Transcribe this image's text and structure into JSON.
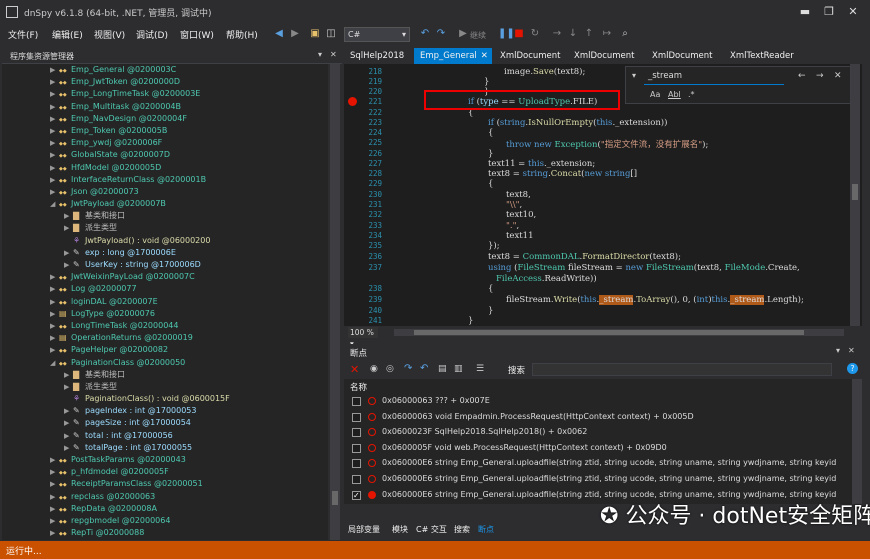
{
  "window": {
    "title": "dnSpy v6.1.8 (64-bit, .NET, 管理员, 调试中)"
  },
  "menu": [
    "文件(F)",
    "编辑(E)",
    "视图(V)",
    "调试(D)",
    "窗口(W)",
    "帮助(H)"
  ],
  "toolbar": {
    "language": "C#",
    "continue_label": "继续"
  },
  "explorer": {
    "title": "程序集资源管理器",
    "items": [
      {
        "icon": "class",
        "indent": 0,
        "exp": "▶",
        "text": "Emp_General @0200003C",
        "k": "t"
      },
      {
        "icon": "class",
        "indent": 0,
        "exp": "▶",
        "text": "Emp_JwtToken @0200000D",
        "k": "t"
      },
      {
        "icon": "class",
        "indent": 0,
        "exp": "▶",
        "text": "Emp_LongTimeTask @0200003E",
        "k": "t"
      },
      {
        "icon": "class",
        "indent": 0,
        "exp": "▶",
        "text": "Emp_Multitask @0200004B",
        "k": "t"
      },
      {
        "icon": "class",
        "indent": 0,
        "exp": "▶",
        "text": "Emp_NavDesign @0200004F",
        "k": "t"
      },
      {
        "icon": "class",
        "indent": 0,
        "exp": "▶",
        "text": "Emp_Token @0200005B",
        "k": "t"
      },
      {
        "icon": "class",
        "indent": 0,
        "exp": "▶",
        "text": "Emp_ywdj @0200006F",
        "k": "t"
      },
      {
        "icon": "class",
        "indent": 0,
        "exp": "▶",
        "text": "GlobalState @0200007D",
        "k": "t"
      },
      {
        "icon": "class",
        "indent": 0,
        "exp": "▶",
        "text": "HfdModel @0200005D",
        "k": "t"
      },
      {
        "icon": "class",
        "indent": 0,
        "exp": "▶",
        "text": "InterfaceReturnClass @0200001B",
        "k": "t"
      },
      {
        "icon": "class",
        "indent": 0,
        "exp": "▶",
        "text": "Json @02000073",
        "k": "t"
      },
      {
        "icon": "class",
        "indent": 0,
        "exp": "◢",
        "text": "JwtPayload @0200007B",
        "k": "t"
      },
      {
        "icon": "folder",
        "indent": 1,
        "exp": "▶",
        "text": "基类和接口",
        "k": "g"
      },
      {
        "icon": "folder",
        "indent": 1,
        "exp": "▶",
        "text": "派生类型",
        "k": "g"
      },
      {
        "icon": "method",
        "indent": 1,
        "exp": "",
        "text": "JwtPayload() : void @06000200",
        "k": "m"
      },
      {
        "icon": "prop",
        "indent": 1,
        "exp": "▶",
        "text": "exp : long @1700006E",
        "k": "f"
      },
      {
        "icon": "prop",
        "indent": 1,
        "exp": "▶",
        "text": "UserKey : string @1700006D",
        "k": "f"
      },
      {
        "icon": "class",
        "indent": 0,
        "exp": "▶",
        "text": "JwtWeixinPayLoad @0200007C",
        "k": "t"
      },
      {
        "icon": "class",
        "indent": 0,
        "exp": "▶",
        "text": "Log @02000077",
        "k": "t"
      },
      {
        "icon": "class",
        "indent": 0,
        "exp": "▶",
        "text": "loginDAL @0200007E",
        "k": "t"
      },
      {
        "icon": "enum",
        "indent": 0,
        "exp": "▶",
        "text": "LogType @02000076",
        "k": "t"
      },
      {
        "icon": "class",
        "indent": 0,
        "exp": "▶",
        "text": "LongTimeTask @02000044",
        "k": "t"
      },
      {
        "icon": "enum",
        "indent": 0,
        "exp": "▶",
        "text": "OperationReturns @02000019",
        "k": "t"
      },
      {
        "icon": "class",
        "indent": 0,
        "exp": "▶",
        "text": "PageHelper @02000082",
        "k": "t"
      },
      {
        "icon": "class",
        "indent": 0,
        "exp": "◢",
        "text": "PaginationClass @02000050",
        "k": "t"
      },
      {
        "icon": "folder",
        "indent": 1,
        "exp": "▶",
        "text": "基类和接口",
        "k": "g"
      },
      {
        "icon": "folder",
        "indent": 1,
        "exp": "▶",
        "text": "派生类型",
        "k": "g"
      },
      {
        "icon": "method",
        "indent": 1,
        "exp": "",
        "text": "PaginationClass() : void @0600015F",
        "k": "m"
      },
      {
        "icon": "prop",
        "indent": 1,
        "exp": "▶",
        "text": "pageIndex : int @17000053",
        "k": "f"
      },
      {
        "icon": "prop",
        "indent": 1,
        "exp": "▶",
        "text": "pageSize : int @17000054",
        "k": "f"
      },
      {
        "icon": "prop",
        "indent": 1,
        "exp": "▶",
        "text": "total : int @17000056",
        "k": "f"
      },
      {
        "icon": "prop",
        "indent": 1,
        "exp": "▶",
        "text": "totalPage : int @17000055",
        "k": "f"
      },
      {
        "icon": "class",
        "indent": 0,
        "exp": "▶",
        "text": "PostTaskParams @02000043",
        "k": "t"
      },
      {
        "icon": "class",
        "indent": 0,
        "exp": "▶",
        "text": "p_hfdmodel @0200005F",
        "k": "t"
      },
      {
        "icon": "class",
        "indent": 0,
        "exp": "▶",
        "text": "ReceiptParamsClass @02000051",
        "k": "t"
      },
      {
        "icon": "class",
        "indent": 0,
        "exp": "▶",
        "text": "repclass @02000063",
        "k": "t"
      },
      {
        "icon": "class",
        "indent": 0,
        "exp": "▶",
        "text": "RepData @0200008A",
        "k": "t"
      },
      {
        "icon": "class",
        "indent": 0,
        "exp": "▶",
        "text": "repgbmodel @02000064",
        "k": "t"
      },
      {
        "icon": "class",
        "indent": 0,
        "exp": "▶",
        "text": "RepTi @02000088",
        "k": "t"
      }
    ]
  },
  "tabs": [
    {
      "label": "SqlHelp2018",
      "active": false
    },
    {
      "label": "Emp_General",
      "active": true
    },
    {
      "label": "XmlDocument",
      "active": false
    },
    {
      "label": "XmlDocument",
      "active": false
    },
    {
      "label": "XmlDocument",
      "active": false
    },
    {
      "label": "XmlTextReader",
      "active": false
    }
  ],
  "editor": {
    "line_numbers": [
      "218",
      "219",
      "220",
      "221",
      "222",
      "223",
      "224",
      "225",
      "226",
      "227",
      "228",
      "229",
      "230",
      "231",
      "232",
      "233",
      "234",
      "235",
      "236",
      "237",
      "",
      "238",
      "239",
      "240",
      "241"
    ],
    "find_text": "_stream",
    "find_opts": [
      "Aa",
      "Abl",
      ".*"
    ],
    "zoom": "100 %"
  },
  "breakpoints": {
    "title": "断点",
    "search_label": "搜索",
    "column_name": "名称",
    "rows": [
      {
        "checked": false,
        "enabled": false,
        "text": "0x06000063 ??? + 0x007E"
      },
      {
        "checked": false,
        "enabled": false,
        "text": "0x06000063 void Empadmin.ProcessRequest(HttpContext context) + 0x005D"
      },
      {
        "checked": false,
        "enabled": false,
        "text": "0x0600023F SqlHelp2018.SqlHelp2018() + 0x0062"
      },
      {
        "checked": false,
        "enabled": false,
        "text": "0x0600005F void web.ProcessRequest(HttpContext context) + 0x09D0"
      },
      {
        "checked": false,
        "enabled": false,
        "text": "0x060000E6 string Emp_General.uploadfile(string ztid, string ucode, string uname, string ywdjname, string keyid"
      },
      {
        "checked": false,
        "enabled": false,
        "text": "0x060000E6 string Emp_General.uploadfile(string ztid, string ucode, string uname, string ywdjname, string keyid"
      },
      {
        "checked": true,
        "enabled": true,
        "text": "0x060000E6 string Emp_General.uploadfile(string ztid, string ucode, string uname, string ywdjname, string keyid"
      }
    ]
  },
  "bottom_tabs": [
    "局部变量",
    "模块",
    "C# 交互",
    "搜索",
    "断点"
  ],
  "watermark": "公众号 · dotNet安全矩阵",
  "status": "运行中..."
}
